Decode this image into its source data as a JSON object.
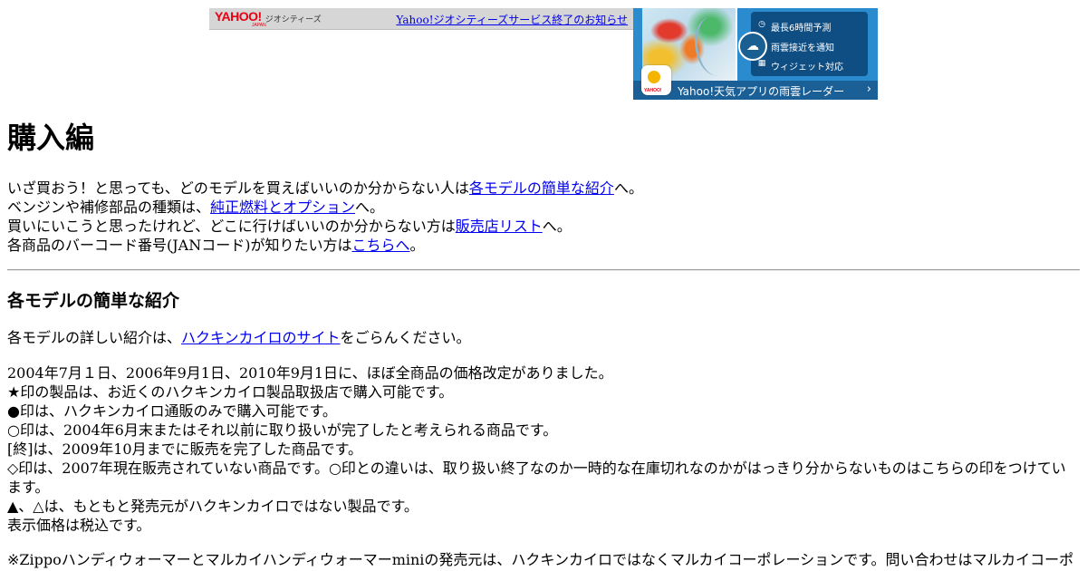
{
  "banner": {
    "logo_text": "YAHOO!",
    "logo_japan": "JAPAN",
    "logo_sub": "ジオシティーズ",
    "notice_link": "Yahoo!ジオシティーズサービス終了のお知らせ"
  },
  "ad": {
    "features": [
      "最長6時間予測",
      "雨雲接近を通知",
      "ウィジェット対応"
    ],
    "footer_text": "Yahoo!天気アプリの雨雲レーダー",
    "app_brand": "YAHOO!"
  },
  "page": {
    "title": "購入編",
    "intro": [
      {
        "before": "いざ買おう！と思っても、どのモデルを買えばいいのか分からない人は",
        "link": "各モデルの簡単な紹介",
        "after": "へ。"
      },
      {
        "before": "ベンジンや補修部品の種類は、",
        "link": "純正燃料とオプション",
        "after": "へ。"
      },
      {
        "before": "買いにいこうと思ったけれど、どこに行けばいいのか分からない方は",
        "link": "販売店リスト",
        "after": "へ。"
      },
      {
        "before": "各商品のバーコード番号(JANコード)が知りたい方は",
        "link": "こちらへ",
        "after": "。"
      }
    ],
    "section_title": "各モデルの簡単な紹介",
    "detail": {
      "before": "各モデルの詳しい紹介は、",
      "link": "ハクキンカイロのサイト",
      "after": "をごらんください。"
    },
    "notes": [
      "2004年7月１日、2006年9月1日、2010年9月1日に、ほぼ全商品の価格改定がありました。",
      "★印の製品は、お近くのハクキンカイロ製品取扱店で購入可能です。",
      "●印は、ハクキンカイロ通販のみで購入可能です。",
      "○印は、2004年6月末またはそれ以前に取り扱いが完了したと考えられる商品です。",
      "[終]は、2009年10月までに販売を完了した商品です。",
      "◇印は、2007年現在販売されていない商品です。○印との違いは、取り扱い終了なのか一時的な在庫切れなのかがはっきり分からないものはこちらの印をつけています。",
      "▲、△は、もともと発売元がハクキンカイロではない製品です。",
      "表示価格は税込です。"
    ],
    "footnote": "※Zippoハンディウォーマーとマルカイハンディウォーマーminiの発売元は、ハクキンカイロではなくマルカイコーポレーションです。問い合わせはマルカイコーポ"
  }
}
